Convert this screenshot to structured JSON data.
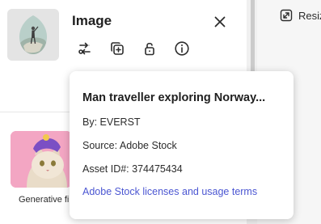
{
  "panel": {
    "title": "Image",
    "thumbnail_icon": "image-thumbnail",
    "tools": [
      "replace-icon",
      "duplicate-icon",
      "unlock-icon",
      "info-icon"
    ],
    "close_icon": "close-icon"
  },
  "canvas_toolbar": {
    "resize_label": "Resiz",
    "resize_icon": "resize-icon"
  },
  "generative": {
    "label": "Generative fi"
  },
  "asset_info": {
    "title": "Man traveller exploring Norway...",
    "by": "By: EVERST",
    "source": "Source: Adobe Stock",
    "asset_id": "Asset ID#: 374475434",
    "link": "Adobe Stock licenses and usage terms",
    "link_color": "#4b56d2"
  }
}
